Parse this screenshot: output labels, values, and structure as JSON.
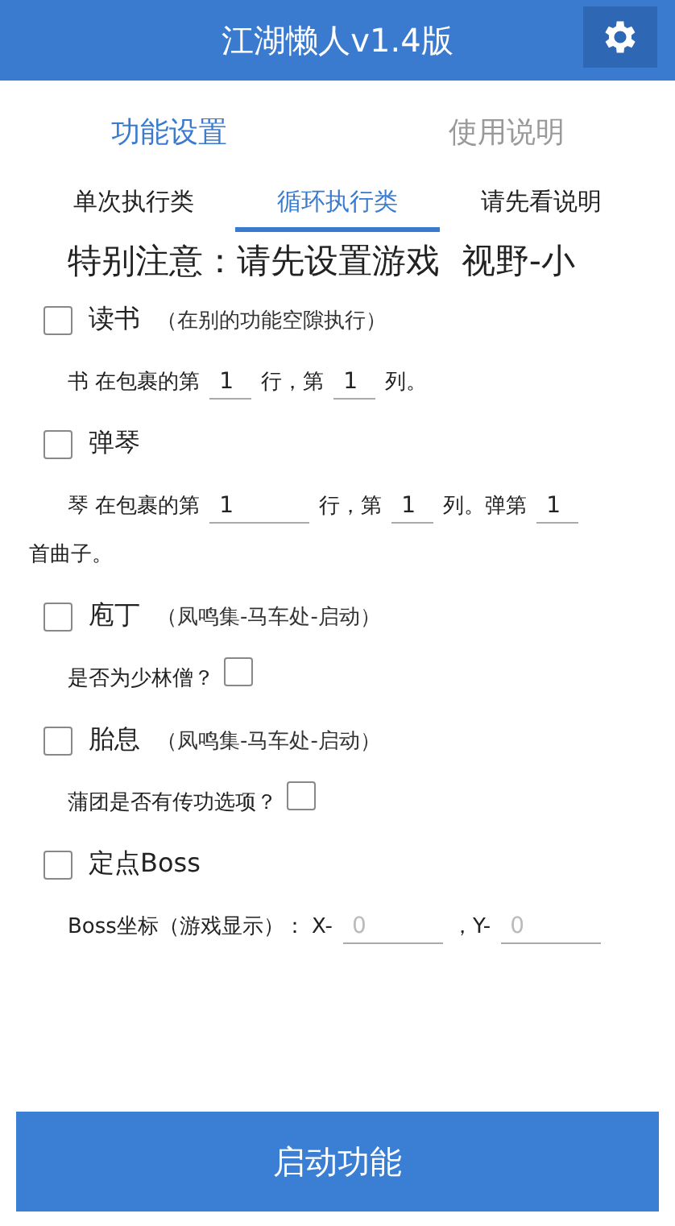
{
  "app_bar": {
    "title": "江湖懒人v1.4版"
  },
  "tabs": [
    {
      "label": "功能设置",
      "selected": true
    },
    {
      "label": "使用说明",
      "selected": false
    }
  ],
  "sub_tabs": [
    {
      "label": "单次执行类",
      "selected": false
    },
    {
      "label": "循环执行类",
      "selected": true
    },
    {
      "label": "请先看说明",
      "selected": false
    }
  ],
  "notice": "特别注意：请先设置游戏  视野-小",
  "options": [
    {
      "label": "读书",
      "note": "（在别的功能空隙执行）",
      "checked": false,
      "rows": [
        [
          {
            "kind": "text",
            "text": "书 在包裹的第"
          },
          {
            "kind": "field",
            "value": "1"
          },
          {
            "kind": "text",
            "text": "行，第"
          },
          {
            "kind": "field",
            "value": "1"
          },
          {
            "kind": "text",
            "text": "列。"
          }
        ]
      ]
    },
    {
      "label": "弹琴",
      "checked": false,
      "rows": [
        [
          {
            "kind": "text",
            "text": "琴 在包裹的第"
          },
          {
            "kind": "wide",
            "value": "1"
          },
          {
            "kind": "text",
            "text": "行，第"
          },
          {
            "kind": "field",
            "value": "1"
          },
          {
            "kind": "text",
            "text": "列。弹第"
          },
          {
            "kind": "field",
            "value": "1"
          },
          {
            "kind": "text",
            "text": "首曲子。"
          }
        ]
      ]
    },
    {
      "label": "庖丁",
      "note": "（凤鸣集-马车处-启动）",
      "checked": false,
      "rows": [
        [
          {
            "kind": "text",
            "text": "是否为少林僧？"
          },
          {
            "kind": "checkbox",
            "checked": false
          }
        ]
      ]
    },
    {
      "label": "胎息",
      "note": "（凤鸣集-马车处-启动）",
      "checked": false,
      "rows": [
        [
          {
            "kind": "text",
            "text": "蒲团是否有传功选项？"
          },
          {
            "kind": "checkbox",
            "checked": false
          }
        ]
      ]
    },
    {
      "label": "定点Boss",
      "checked": false,
      "rows": [
        [
          {
            "kind": "text",
            "text": "Boss坐标（游戏显示）： X-"
          },
          {
            "kind": "wide",
            "placeholder": "0"
          },
          {
            "kind": "text",
            "text": "，Y-"
          },
          {
            "kind": "wide",
            "placeholder": "0"
          }
        ]
      ]
    }
  ],
  "start_button": "启动功能"
}
